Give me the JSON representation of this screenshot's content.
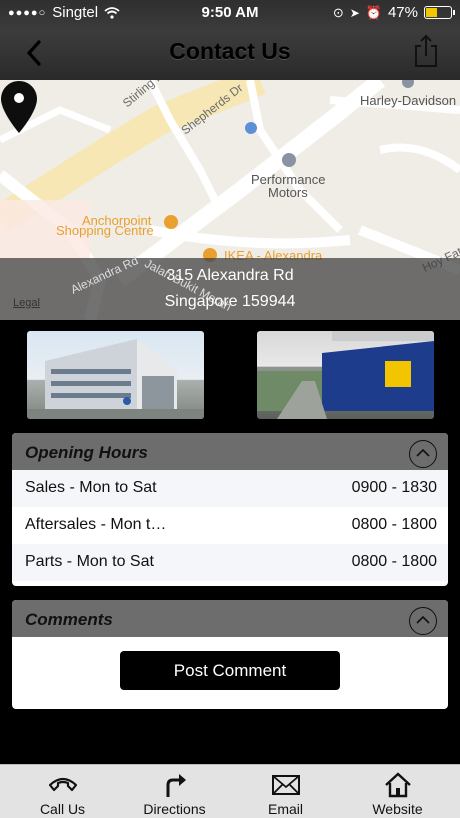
{
  "status": {
    "carrier": "Singtel",
    "time": "9:50 AM",
    "battery": "47%",
    "battery_level": 0.47
  },
  "header": {
    "title": "Contact Us"
  },
  "map": {
    "labels": [
      "Stirling Rd",
      "Shepherds Dr",
      "Harley-Davidson",
      "Performance",
      "Motors",
      "Anchorpoint",
      "Shopping Centre",
      "IKEA - Alexandra",
      "Alexandra Rd",
      "Jalan Bukit Merah",
      "Hoy Fatt Rd"
    ],
    "legal": "Legal",
    "address_line1": "315 Alexandra Rd",
    "address_line2": "Singapore 159944"
  },
  "opening_hours": {
    "title": "Opening Hours",
    "rows": [
      {
        "label": "Sales - Mon to Sat",
        "hours": "0900 - 1830"
      },
      {
        "label": "Aftersales - Mon t…",
        "hours": "0800 - 1800"
      },
      {
        "label": "Parts - Mon to Sat",
        "hours": "0800 - 1800"
      }
    ]
  },
  "comments": {
    "title": "Comments",
    "post_label": "Post Comment"
  },
  "tabs": [
    {
      "label": "Call Us",
      "icon": "phone-icon"
    },
    {
      "label": "Directions",
      "icon": "directions-icon"
    },
    {
      "label": "Email",
      "icon": "email-icon"
    },
    {
      "label": "Website",
      "icon": "home-icon"
    }
  ],
  "colors": {
    "accent": "#f3c700",
    "header_bg": "#6d6d6d",
    "button_bg": "#000000",
    "map_label": "#e8a030"
  }
}
